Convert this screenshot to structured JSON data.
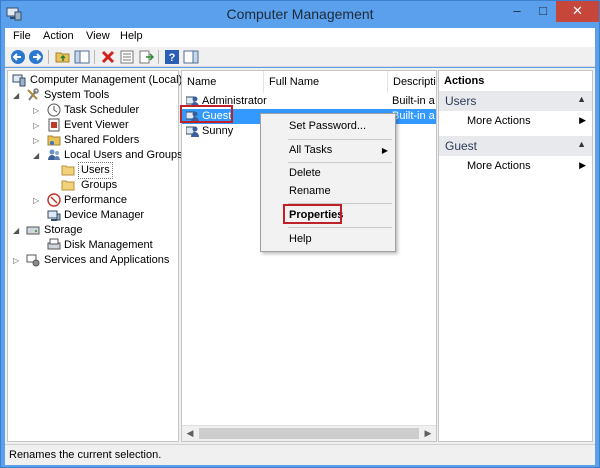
{
  "window": {
    "title": "Computer Management",
    "controls": {
      "minimize": "–",
      "maximize": "□",
      "close": "✕"
    }
  },
  "menu": [
    "File",
    "Action",
    "View",
    "Help"
  ],
  "toolbar": {
    "buttons": [
      "back-icon",
      "forward-icon",
      "up-folder-icon",
      "show-hide-tree-icon",
      "delete-icon",
      "properties-icon",
      "export-list-icon",
      "help-icon",
      "show-hide-action-pane-icon"
    ]
  },
  "tree": {
    "root": "Computer Management (Local)",
    "system_tools": "System Tools",
    "task_scheduler": "Task Scheduler",
    "event_viewer": "Event Viewer",
    "shared_folders": "Shared Folders",
    "local_users_groups": "Local Users and Groups",
    "users": "Users",
    "groups": "Groups",
    "performance": "Performance",
    "device_manager": "Device Manager",
    "storage": "Storage",
    "disk_management": "Disk Management",
    "services_apps": "Services and Applications"
  },
  "list": {
    "columns": {
      "name": "Name",
      "full_name": "Full Name",
      "description": "Descriptio"
    },
    "rows": [
      {
        "name": "Administrator",
        "description": "Built-in a"
      },
      {
        "name": "Guest",
        "description": "Built-in a"
      },
      {
        "name": "Sunny",
        "description": ""
      }
    ]
  },
  "actions": {
    "title": "Actions",
    "sections": [
      {
        "label": "Users",
        "item": "More Actions"
      },
      {
        "label": "Guest",
        "item": "More Actions"
      }
    ]
  },
  "context_menu": {
    "set_password": "Set Password...",
    "all_tasks": "All Tasks",
    "delete": "Delete",
    "rename": "Rename",
    "properties": "Properties",
    "help": "Help"
  },
  "status": "Renames the current selection.",
  "colors": {
    "titlebar": "#5aa0ec",
    "selection": "#3399ff",
    "highlight": "#c0202a",
    "close": "#c7463b"
  }
}
